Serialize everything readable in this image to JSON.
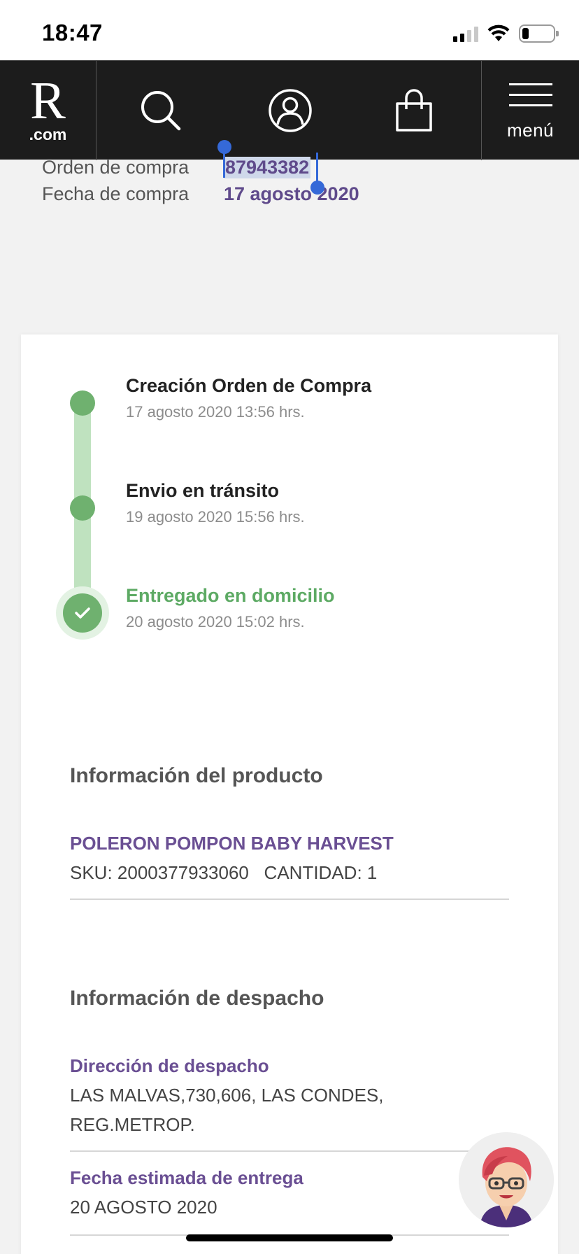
{
  "status_bar": {
    "time": "18:47"
  },
  "header": {
    "logo_main": "R",
    "logo_sub": ".com",
    "menu_label": "menú",
    "icons": [
      "search-icon",
      "user-icon",
      "bag-icon",
      "menu-icon"
    ]
  },
  "order": {
    "order_label": "Orden de compra",
    "order_number": "87943382",
    "date_label": "Fecha de compra",
    "date_value": "17 agosto 2020"
  },
  "timeline": [
    {
      "title": "Creación Orden de Compra",
      "date": "17 agosto 2020 13:56 hrs.",
      "status": "done"
    },
    {
      "title": "Envio en tránsito",
      "date": "19 agosto 2020 15:56 hrs.",
      "status": "done"
    },
    {
      "title": "Entregado en domicilio",
      "date": "20 agosto 2020 15:02 hrs.",
      "status": "current"
    }
  ],
  "product_info": {
    "title": "Información del producto",
    "name": "POLERON POMPON BABY HARVEST",
    "sku_line": "SKU: 2000377933060   CANTIDAD: 1"
  },
  "shipping_info": {
    "title": "Información de despacho",
    "address_label": "Dirección de despacho",
    "address_line1": "LAS MALVAS,730,606, LAS CONDES,",
    "address_line2": "REG.METROP.",
    "eta_label": "Fecha estimada de entrega",
    "eta_value": "20 AGOSTO 2020"
  },
  "colors": {
    "header_bg": "#1c1c1c",
    "accent_purple": "#6a4f93",
    "success_green": "#5daa64",
    "selection_blue": "#3569d8"
  }
}
